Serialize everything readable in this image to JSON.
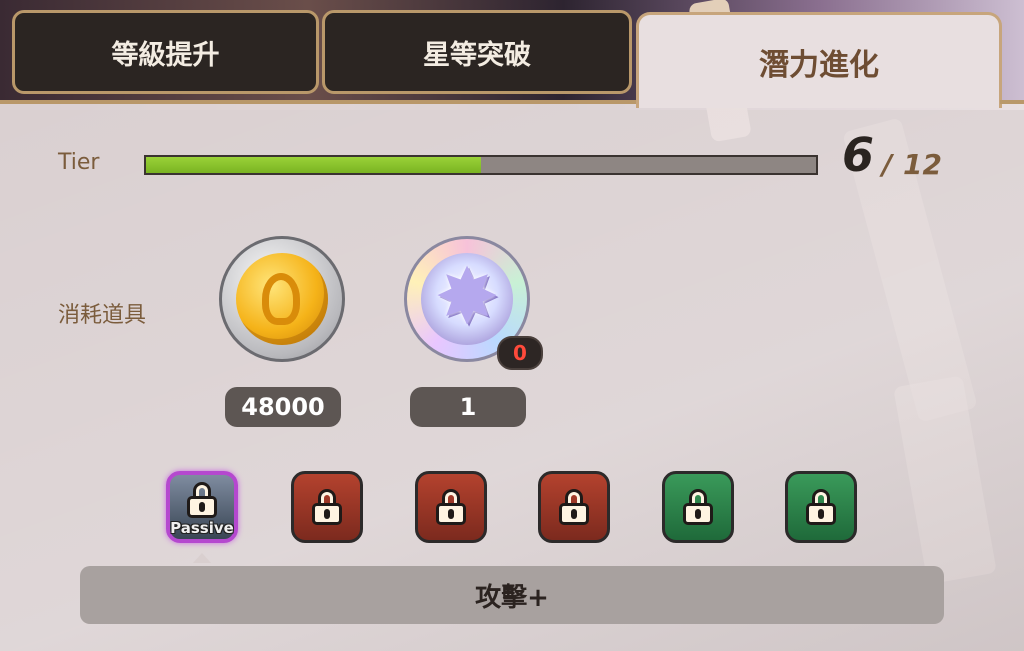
{
  "tabs": [
    {
      "label": "等級提升",
      "active": false
    },
    {
      "label": "星等突破",
      "active": false
    },
    {
      "label": "潛力進化",
      "active": true
    }
  ],
  "tier": {
    "label": "Tier",
    "current": "6",
    "separator": "/",
    "max": "12",
    "progress": 0.5
  },
  "consumables": {
    "label": "消耗道具",
    "items": [
      {
        "icon": "gold-coin-icon",
        "quantity": "48000"
      },
      {
        "icon": "crystal-icon",
        "quantity": "1",
        "owned": "0"
      }
    ]
  },
  "skills": {
    "slots": [
      {
        "type": "passive",
        "label": "Passive",
        "locked": true,
        "color": "#b548cf"
      },
      {
        "type": "red",
        "locked": true,
        "color": "#b4422e"
      },
      {
        "type": "red",
        "locked": true,
        "color": "#b4422e"
      },
      {
        "type": "red",
        "locked": true,
        "color": "#b4422e"
      },
      {
        "type": "green",
        "locked": true,
        "color": "#3a9a5a"
      },
      {
        "type": "green",
        "locked": true,
        "color": "#3a9a5a"
      }
    ],
    "selected_description": "攻擊+"
  },
  "colors": {
    "progress_fill": "#9ad238",
    "accent_gold": "#b9986a",
    "owned_zero": "#ff4a3b"
  }
}
